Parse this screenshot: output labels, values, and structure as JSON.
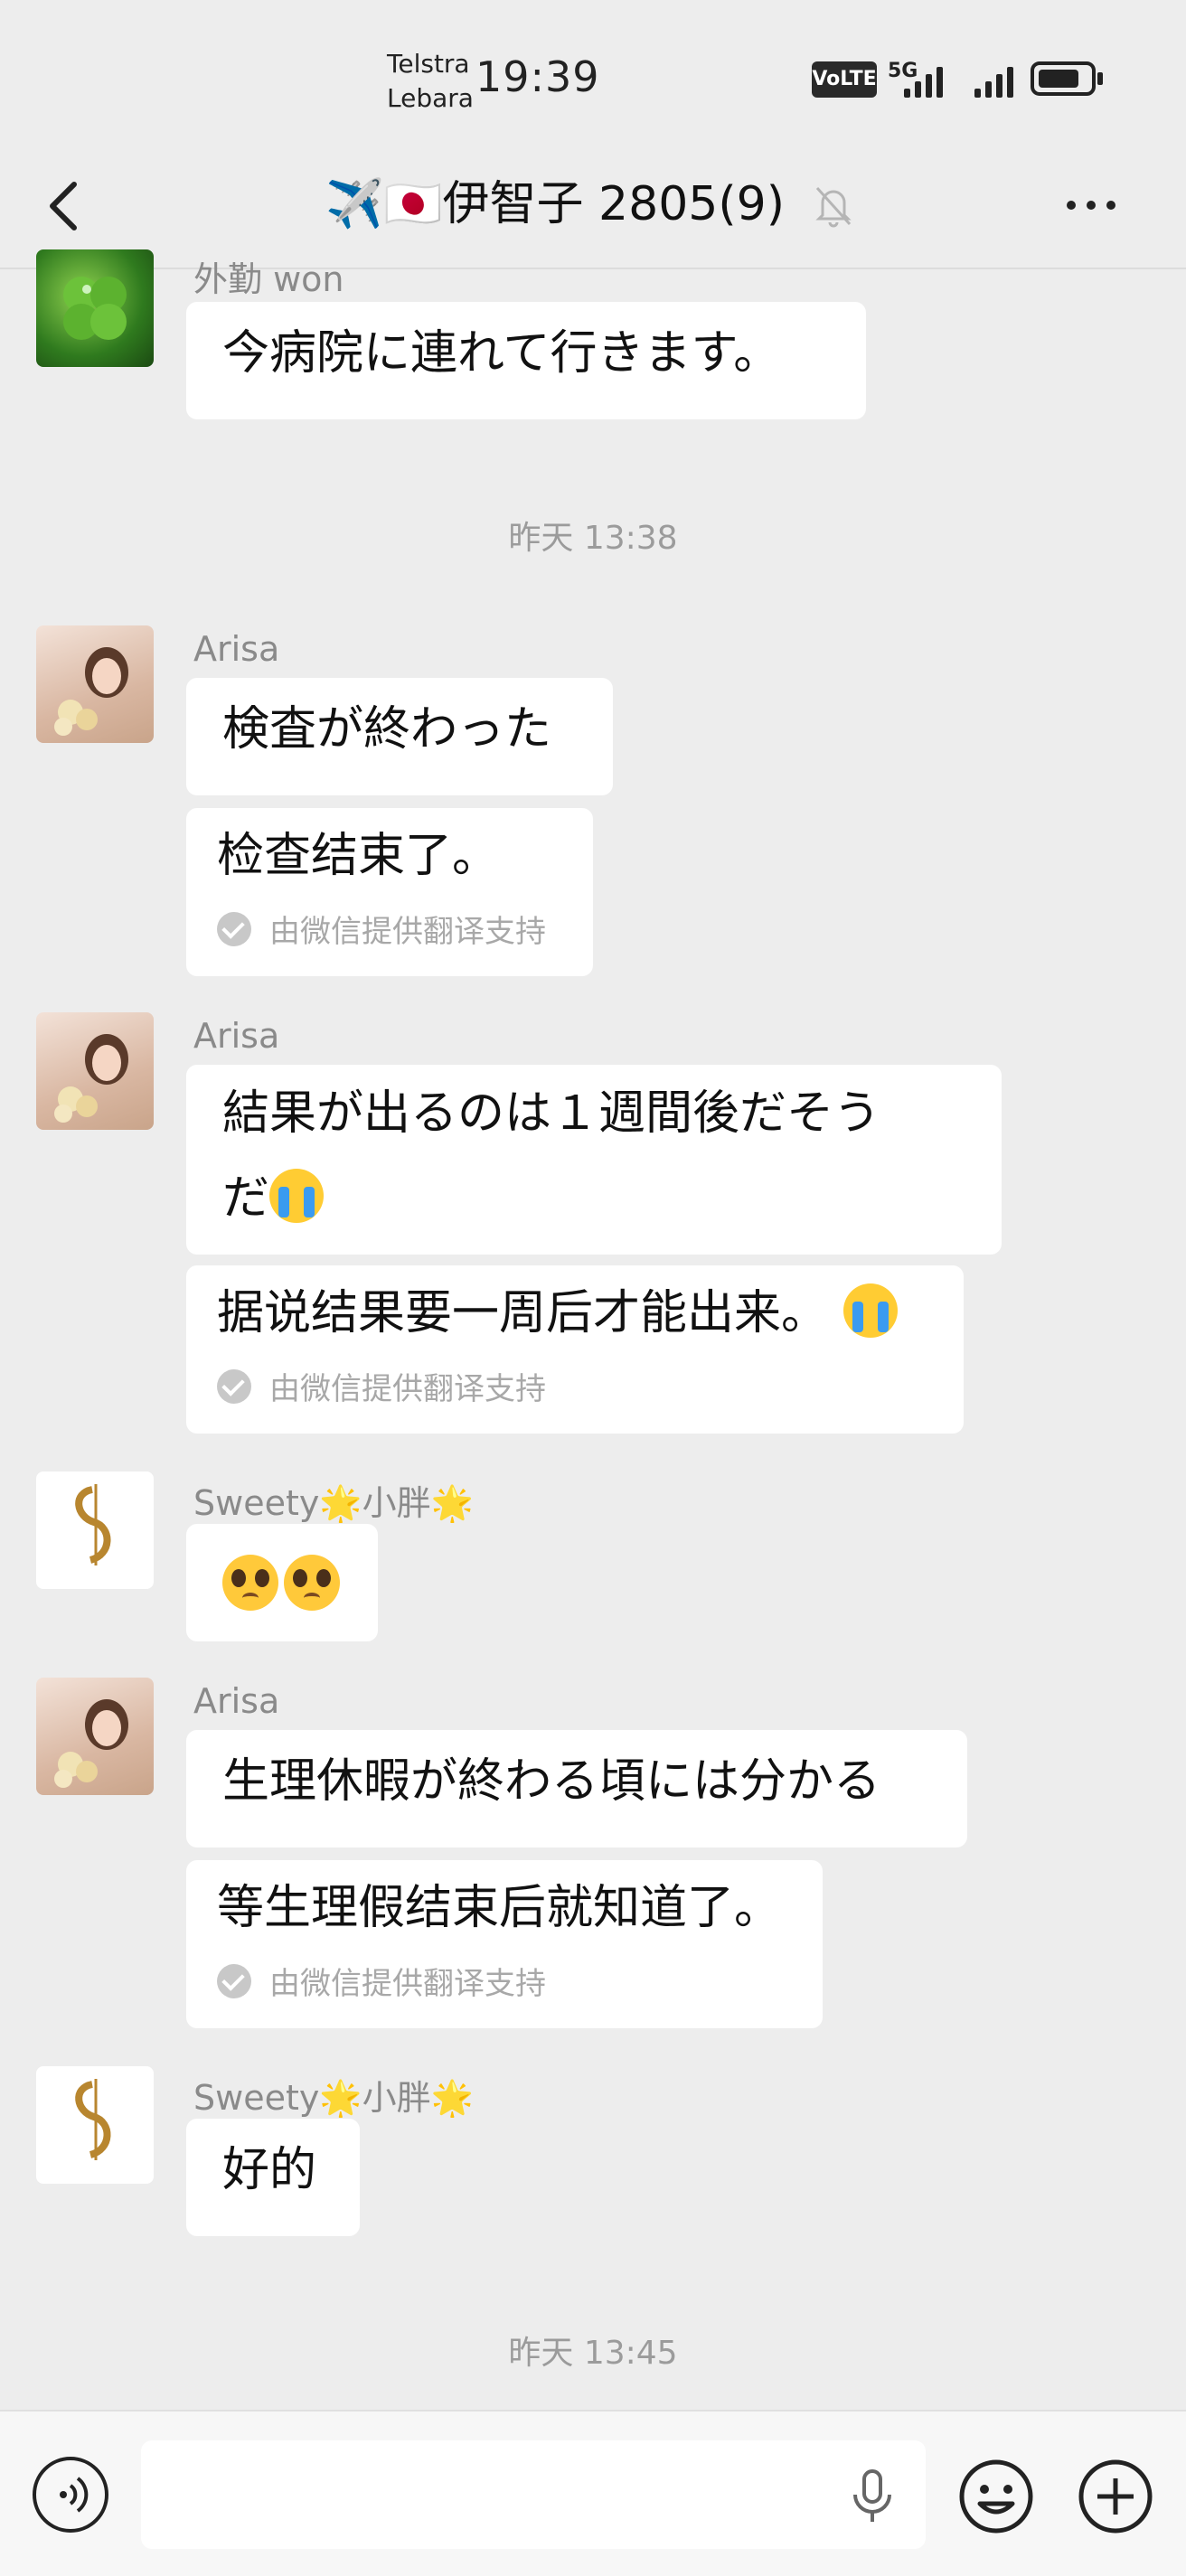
{
  "status_bar": {
    "carrier_1": "Telstra",
    "carrier_2": "Lebara",
    "time": "19:39",
    "volte": "VoLTE",
    "volte_sim": "1 2",
    "network": "5G"
  },
  "nav": {
    "title": "✈️🇯🇵伊智子 2805(9)",
    "back_icon": "chevron-left-icon",
    "mute_icon": "bell-off-icon",
    "more_icon": "more-dots-icon"
  },
  "messages": {
    "m0": {
      "sender": "外勤 won",
      "text": "今病院に連れて行きます。"
    },
    "ts1": "昨天 13:38",
    "m1": {
      "sender": "Arisa",
      "text": "検査が終わった",
      "translation": "检查结束了。",
      "note": "由微信提供翻译支持"
    },
    "m2": {
      "sender": "Arisa",
      "line1": "結果が出るのは１週間後だそう",
      "line2": "だ",
      "translation": "据说结果要一周后才能出来。",
      "note": "由微信提供翻译支持"
    },
    "m3": {
      "sender": "Sweety🌟小胖🌟"
    },
    "m4": {
      "sender": "Arisa",
      "text": "生理休暇が終わる頃には分かる",
      "translation": "等生理假结束后就知道了。",
      "note": "由微信提供翻译支持"
    },
    "m5": {
      "sender": "Sweety🌟小胖🌟",
      "text": "好的"
    },
    "ts2": "昨天 13:45"
  },
  "input_bar": {
    "voice_icon": "voice-mode-icon",
    "mic_icon": "microphone-icon",
    "emoji_icon": "emoji-smile-icon",
    "plus_icon": "plus-circle-icon"
  },
  "colors": {
    "background": "#ededed",
    "bubble": "#ffffff",
    "meta_text": "#9b9b9b"
  }
}
